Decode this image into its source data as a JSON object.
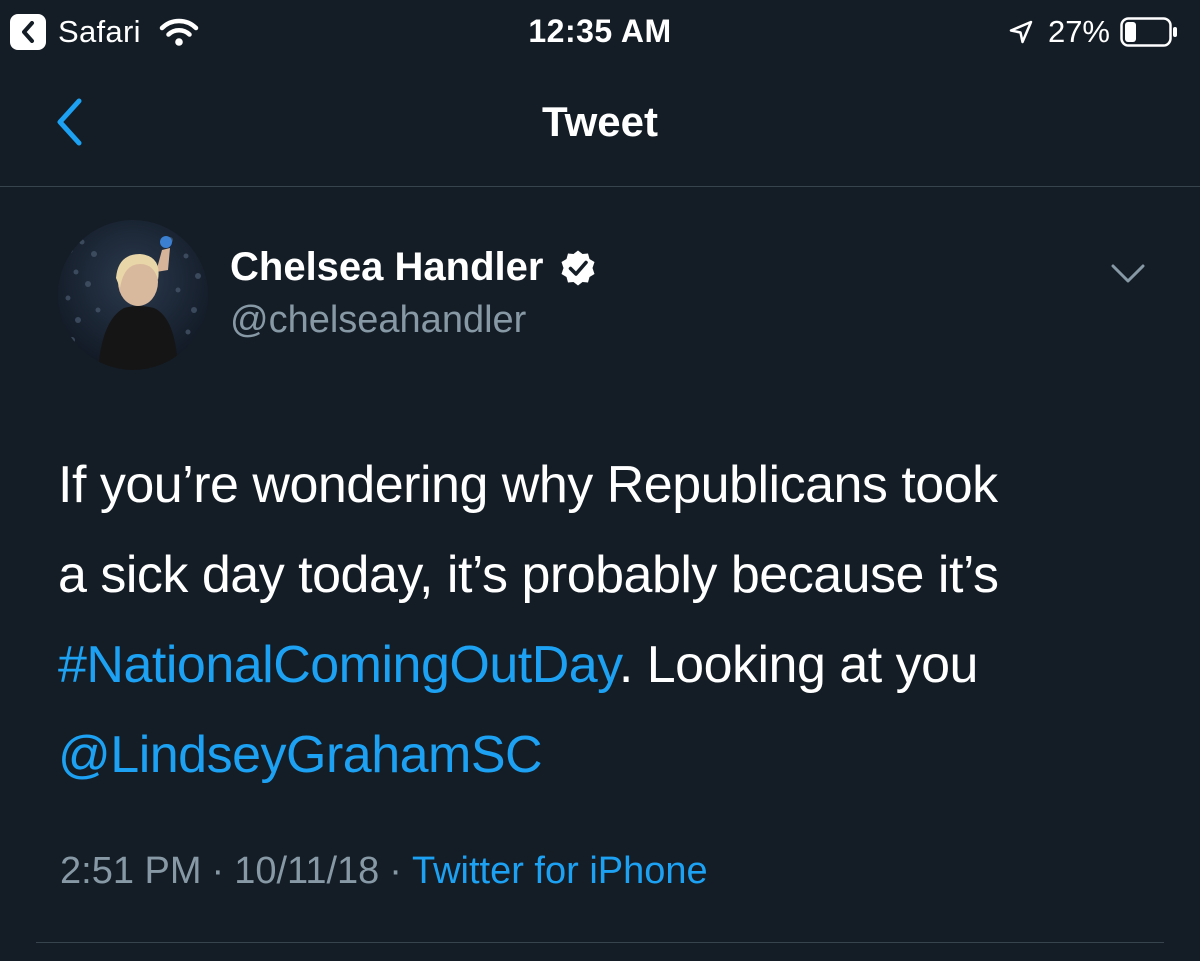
{
  "status_bar": {
    "back_app": "Safari",
    "time": "12:35 AM",
    "battery_percent": "27%",
    "battery_level": 0.27,
    "icons": [
      "back-chevron-icon",
      "wifi-icon",
      "location-arrow-icon",
      "battery-icon"
    ]
  },
  "nav": {
    "title": "Tweet",
    "back_icon": "chevron-left-icon"
  },
  "tweet": {
    "author_name": "Chelsea Handler",
    "author_handle": "@chelseahandler",
    "verified": true,
    "text": {
      "line1": "If you’re wondering why Republicans took",
      "line2": "a sick day today, it’s probably because it’s",
      "hashtag": "#NationalComingOutDay",
      "after_hashtag": ". Looking at you",
      "mention": "@LindseyGrahamSC"
    },
    "time": "2:51 PM",
    "separator": "·",
    "date": "10/11/18",
    "source": "Twitter for iPhone"
  },
  "colors": {
    "background": "#141d26",
    "link": "#1da1f2",
    "secondary_text": "#8899a6",
    "divider": "#38444d"
  }
}
